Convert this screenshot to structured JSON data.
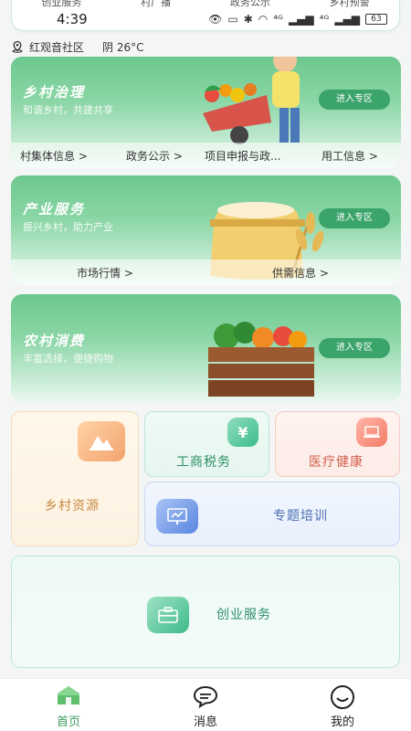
{
  "top_strip": {
    "items": [
      "创业服务",
      "村广播",
      "政务公示",
      "乡村预警"
    ]
  },
  "status": {
    "time": "4:39",
    "signal1": "⁴ᴳ",
    "signal2": "⁴ᴳ",
    "battery": "63"
  },
  "location": {
    "community": "红观音社区",
    "weather": "阴 26°C"
  },
  "banners": [
    {
      "title": "乡村治理",
      "subtitle": "和谐乡村，共建共享",
      "enter": "进入专区",
      "links": [
        "村集体信息 >",
        "政务公示 >",
        "项目申报与政...",
        "用工信息 >"
      ]
    },
    {
      "title": "产业服务",
      "subtitle": "振兴乡村，助力产业",
      "enter": "进入专区",
      "links": [
        "市场行情 >",
        "供需信息 >"
      ]
    },
    {
      "title": "农村消费",
      "subtitle": "丰富选择，便捷购物",
      "enter": "进入专区",
      "links": []
    }
  ],
  "services": {
    "rural_resources": "乡村资源",
    "business_tax": "工商税务",
    "medical_health": "医疗健康",
    "special_training": "专题培训",
    "entrepreneurship": "创业服务"
  },
  "nav": {
    "home": "首页",
    "messages": "消息",
    "mine": "我的"
  },
  "colors": {
    "brand_green": "#3aa46a",
    "tab_active": "#3a9c5e"
  }
}
